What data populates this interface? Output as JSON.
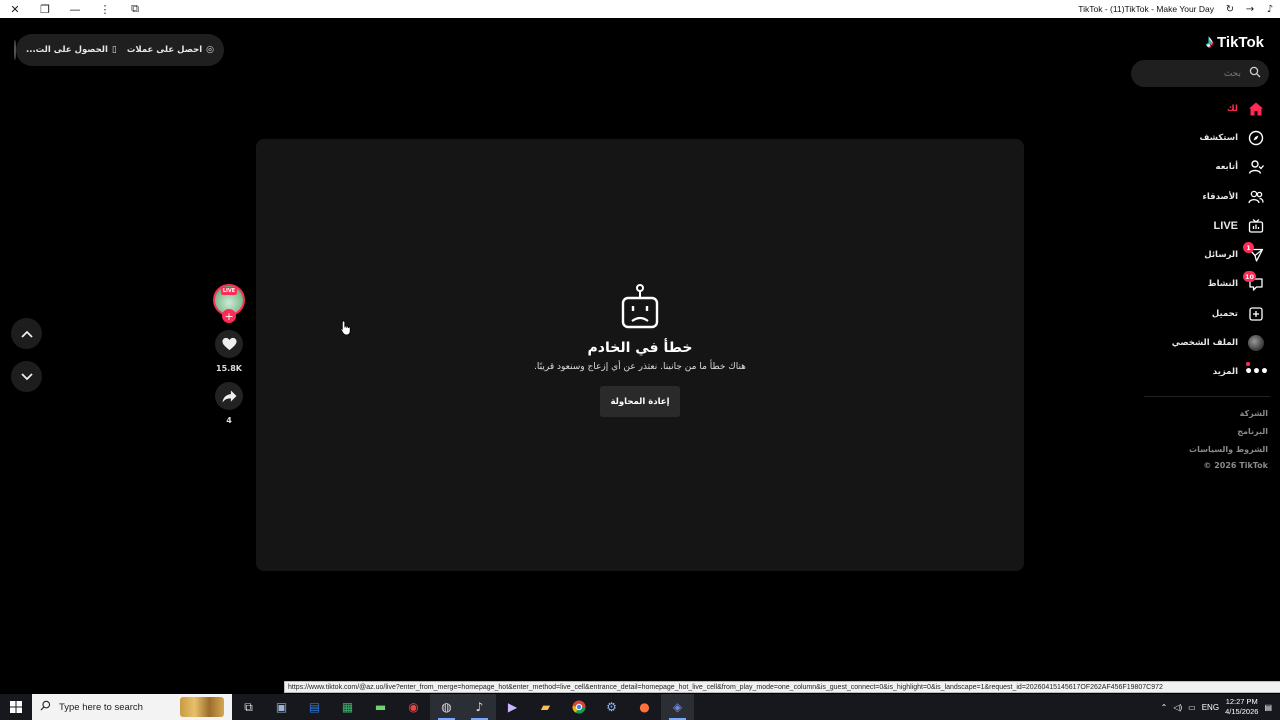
{
  "window": {
    "title": "TikTok - (11)TikTok - Make Your Day"
  },
  "top_pill": {
    "get_coins": "احصل على عملات",
    "get_app": "الحصول على الت..."
  },
  "brand": {
    "logo_text": "TikTok"
  },
  "search": {
    "placeholder": "بحث"
  },
  "nav": {
    "items": [
      {
        "label": "لك",
        "icon": "home-icon",
        "active": true
      },
      {
        "label": "استكشف",
        "icon": "compass-icon"
      },
      {
        "label": "أتابعه",
        "icon": "following-icon"
      },
      {
        "label": "الأصدقاء",
        "icon": "friends-icon"
      },
      {
        "label": "LIVE",
        "icon": "live-tv-icon"
      },
      {
        "label": "الرسائل",
        "icon": "messages-icon",
        "badge": "1"
      },
      {
        "label": "النشاط",
        "icon": "activity-icon",
        "badge": "10"
      },
      {
        "label": "تحميل",
        "icon": "upload-icon"
      },
      {
        "label": "الملف الشخصي",
        "icon": "profile-avatar"
      },
      {
        "label": "المزيد",
        "icon": "more-icon",
        "dot": true
      }
    ]
  },
  "footer": {
    "links": [
      "الشركة",
      "البرنامج",
      "الشروط والسياسات"
    ],
    "copyright": "© 2026 TikTok"
  },
  "error": {
    "title": "خطأ في الخادم",
    "description": "هناك خطأ ما من جانبنا. نعتذر عن أي إزعاج وسنعود قريبًا.",
    "retry_label": "إعادة المحاولة"
  },
  "actions": {
    "live_tag": "LIVE",
    "likes": "15.8K",
    "shares": "4"
  },
  "status_url": "https://www.tiktok.com/@az.uo/live?enter_from_merge=homepage_hot&enter_method=live_cell&entrance_detail=homepage_hot_live_cell&from_play_mode=one_column&is_guest_connect=0&is_highlight=0&is_landscape=1&request_id=20260415145617OF262AF456F19807C972",
  "taskbar": {
    "search_placeholder": "Type here to search",
    "language": "ENG",
    "time": "12:27 PM",
    "date": "4/15/2026"
  },
  "colors": {
    "accent": "#fe2c55",
    "background": "#000000",
    "player": "#151515"
  }
}
